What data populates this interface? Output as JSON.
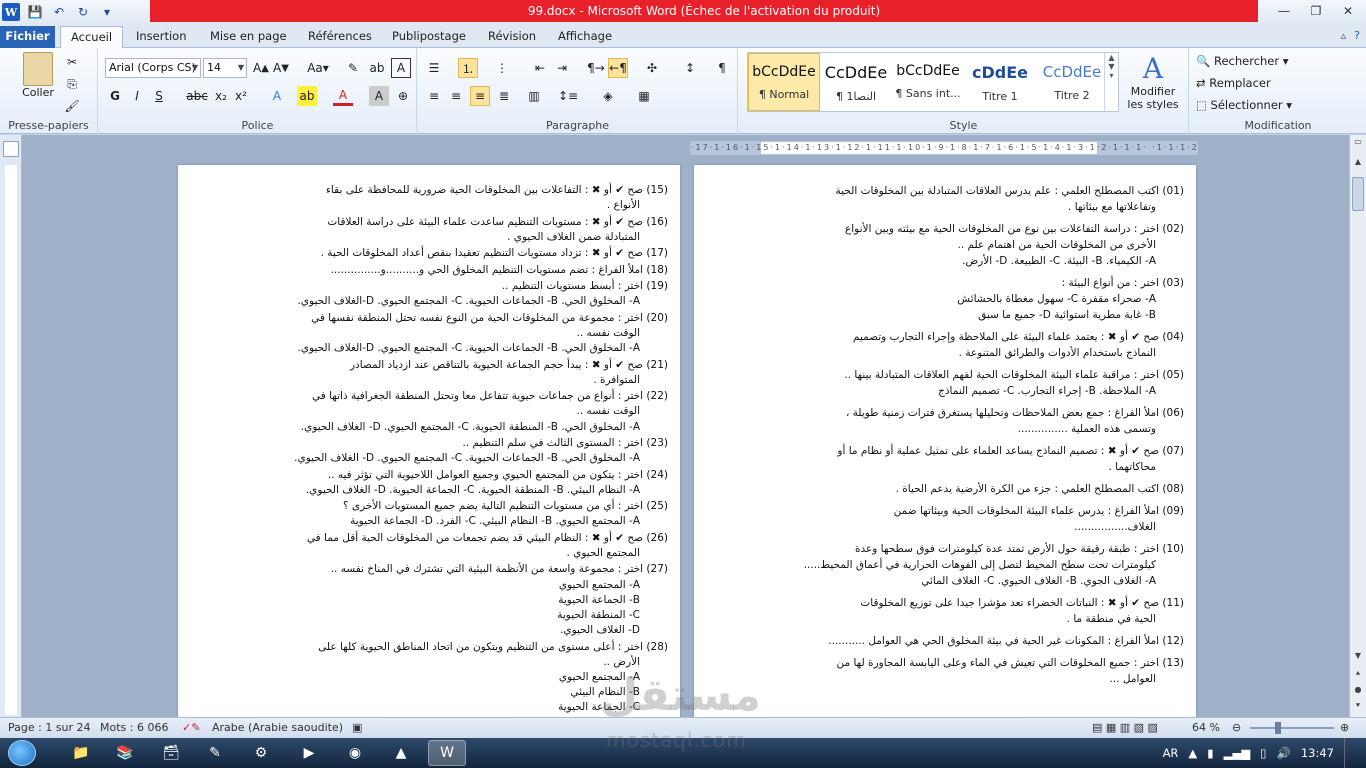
{
  "window": {
    "title": "99.docx  -  Microsoft Word (Échec de l'activation du produit)",
    "controls": [
      "—",
      "❐",
      "✕"
    ]
  },
  "tabs": {
    "file": "Fichier",
    "items": [
      "Accueil",
      "Insertion",
      "Mise en page",
      "Références",
      "Publipostage",
      "Révision",
      "Affichage"
    ]
  },
  "ribbon": {
    "clipboard": {
      "label": "Presse-papiers",
      "paste": "Coller"
    },
    "font": {
      "label": "Police",
      "family": "Arial (Corps CS)",
      "size": "14",
      "bold": "G",
      "italic": "I",
      "underline": "S"
    },
    "paragraph": {
      "label": "Paragraphe"
    },
    "styles": {
      "label": "Style",
      "items": [
        {
          "sample": "bCcDdEe",
          "name": "¶ Normal"
        },
        {
          "sample": "CcDdEe",
          "name": "¶ النصا1"
        },
        {
          "sample": "bCcDdEe",
          "name": "¶ Sans int..."
        },
        {
          "sample": "cDdEe",
          "name": "Titre 1"
        },
        {
          "sample": "CcDdEe",
          "name": "Titre 2"
        }
      ],
      "change_styles": "Modifier les styles"
    },
    "editing": {
      "label": "Modification",
      "find": "Rechercher",
      "replace": "Remplacer",
      "select": "Sélectionner"
    }
  },
  "ruler": {
    "text": "·17·1·16·1·15·1·14·1·13·1·12·1·11·1·10·1·9·1·8·1·7·1·6·1·5·1·4·1·3·1·2·1·1·1· ·1·1·1·2·1·3"
  },
  "doc": {
    "left_page": [
      "(15)   صح ✔ أو ✖ : التفاعلات بين المخلوقات الحية ضرورية للمحافظة على بقاء",
      "الأنواع .",
      "(16)   صح ✔ أو ✖ : مستويات التنظيم ساعدت علماء البيئة على دراسة العلاقات",
      "المتبادلة ضمن الغلاف الحيوي .",
      "(17)   صح ✔ أو ✖ : تزداد مستويات التنظيم تعقيدا بنقص أعداد المخلوقات الحية .",
      "(18)   املأ الفراغ : تضم مستويات التنظيم المخلوق الحي و..........و...............",
      "(19)   اختر : أبسط مستويات التنظيم ..",
      "A- المخلوق الحي. B- الجماعات الحيوية. C- المجتمع الحيوي. D-الغلاف الحيوي.",
      "(20)   اختر : مجموعة من المخلوقات الحية من النوع نفسه تحتل المنطقة نفسها في",
      "الوقت نفسه ..",
      "A- المخلوق الحي. B- الجماعات الحيوية. C- المجتمع الحيوي. D-الغلاف الحيوي.",
      "(21)   صح ✔ أو ✖ : يبدأ حجم الجماعة الحيوية بالتناقص عند ازدياد المصادر",
      "المتوافرة .",
      "(22)   اختر : أنواع من جماعات حيوية تتفاعل معا وتحتل المنطقة الجغرافية ذاتها في",
      "الوقت نفسه ..",
      "A- المخلوق الحي. B- المنطقة الحيوية. C- المجتمع الحيوي. D- الغلاف الحيوي.",
      "(23)   اختر : المستوى الثالث في سلم التنظيم ..",
      "A- المخلوق الحي. B- الجماعات الحيوية. C- المجتمع الحيوي. D- الغلاف الحيوي.",
      "(24)   اختر : يتكون من المجتمع الحيوي وجميع العوامل اللاحيوية التي تؤثر فيه ..",
      "A- النظام البيئي. B- المنطقة الحيوية. C- الجماعة الحيوية. D- الغلاف الحيوي.",
      "(25)   اختر : أي من مستويات التنظيم التالية يضم جميع المستويات الأخرى ؟",
      "A- المجتمع الحيوي. B- النظام البيئي. C- الفرد. D- الجماعة الحيوية",
      "(26)   صح ✔ أو ✖ : النظام البيئي قد يضم تجمعات من المخلوقات الحية أقل مما في",
      "المجتمع الحيوي .",
      "(27)   اختر : مجموعة واسعة من الأنظمة البيئية التي تشترك في المناخ نفسه ..",
      "A- المجتمع الحيوي",
      "B- الجماعة الحيوية",
      "C- المنطقة الحيوية",
      "D- الغلاف الحيوي.",
      "(28)   اختر : أعلى مستوى من التنظيم ويتكون من اتحاد المناطق الحيوية كلها على",
      "الأرض ..",
      "A- المجتمع الحيوي",
      "B- النظام البيئي",
      "C- الجماعة الحيوية"
    ],
    "right_page": [
      "(01)   اكتب المصطلح العلمي : علم يدرس العلاقات المتبادلة بين المخلوقات الحية",
      "وتفاعلاتها مع بيئاتها .",
      "(02)   اختر : دراسة التفاعلات بين نوع من المخلوقات الحية مع بيئته وبين الأنواع",
      "الأخرى من المخلوقات الحية من اهتمام علم ..",
      "A- الكيمياء. B- البيئة. C- الطبيعة. D- الأرض.",
      "(03)   اختر : من أنواع البيئة :",
      "A- صحراء مقفرة          C- سهول مغطاة بالحشائش",
      "B- غابة مطرية استوائية          D- جميع ما سبق",
      "(04)   صح ✔ أو ✖ : يعتمد علماء البيئة على الملاحظة وإجراء التجارب وتصميم",
      "النماذج باستخدام الأدوات والطرائق المتنوعة .",
      "(05)   اختر : مراقبة علماء البيئة المخلوقات الحية لفهم العلاقات المتبادلة بينها ..",
      "A- الملاحظة. B- إجراء التجارب. C- تصميم النماذج",
      "(06)   املأ الفراغ : جمع بعض الملاحظات وتحليلها يستغرق فترات زمنية طويلة ،",
      "وتسمى هذه العملية ...............",
      "(07)   صح ✔ أو ✖ : تصميم النماذج يساعد العلماء على تمثيل عملية أو نظام ما أو",
      "محاكاتهما .",
      "(08)   اكتب المصطلح العلمي : جزء من الكرة الأرضية يدعم الحياة .",
      "(09)   املأ الفراغ : يدرس علماء البيئة المخلوقات الحية وبيئاتها ضمن",
      "الغلاف................",
      "(10)   اختر : طبقة رقيقة حول الأرض تمتد عدة كيلومترات فوق سطحها وعدة",
      "كيلومترات تحت سطح المحيط لتصل إلى الفوهات الحرارية في أعماق المحيط.....",
      "A- الغلاف الجوي. B- الغلاف الحيوي. C- الغلاف المائي",
      "(11)   صح ✔ أو ✖ : النباتات الخضراء تعد مؤشرا جيدا على توزيع المخلوقات",
      "الحية في منطقة ما .",
      "(12)   املأ الفراغ : المكونات غير الحية في بيئة المخلوق الحي هي العوامل ...........",
      "(13)   اختر : جميع المخلوقات التي تعيش في الماء وعلى اليابسة المجاورة لها من",
      "العوامل ..."
    ]
  },
  "status": {
    "page": "Page : 1 sur 24",
    "words": "Mots : 6 066",
    "language": "Arabe (Arabie saoudite)",
    "zoom": "64 %"
  },
  "taskbar": {
    "lang": "AR",
    "time": "13:47"
  },
  "watermark": {
    "arabic": "مستقل",
    "latin": "mostaql.com"
  }
}
